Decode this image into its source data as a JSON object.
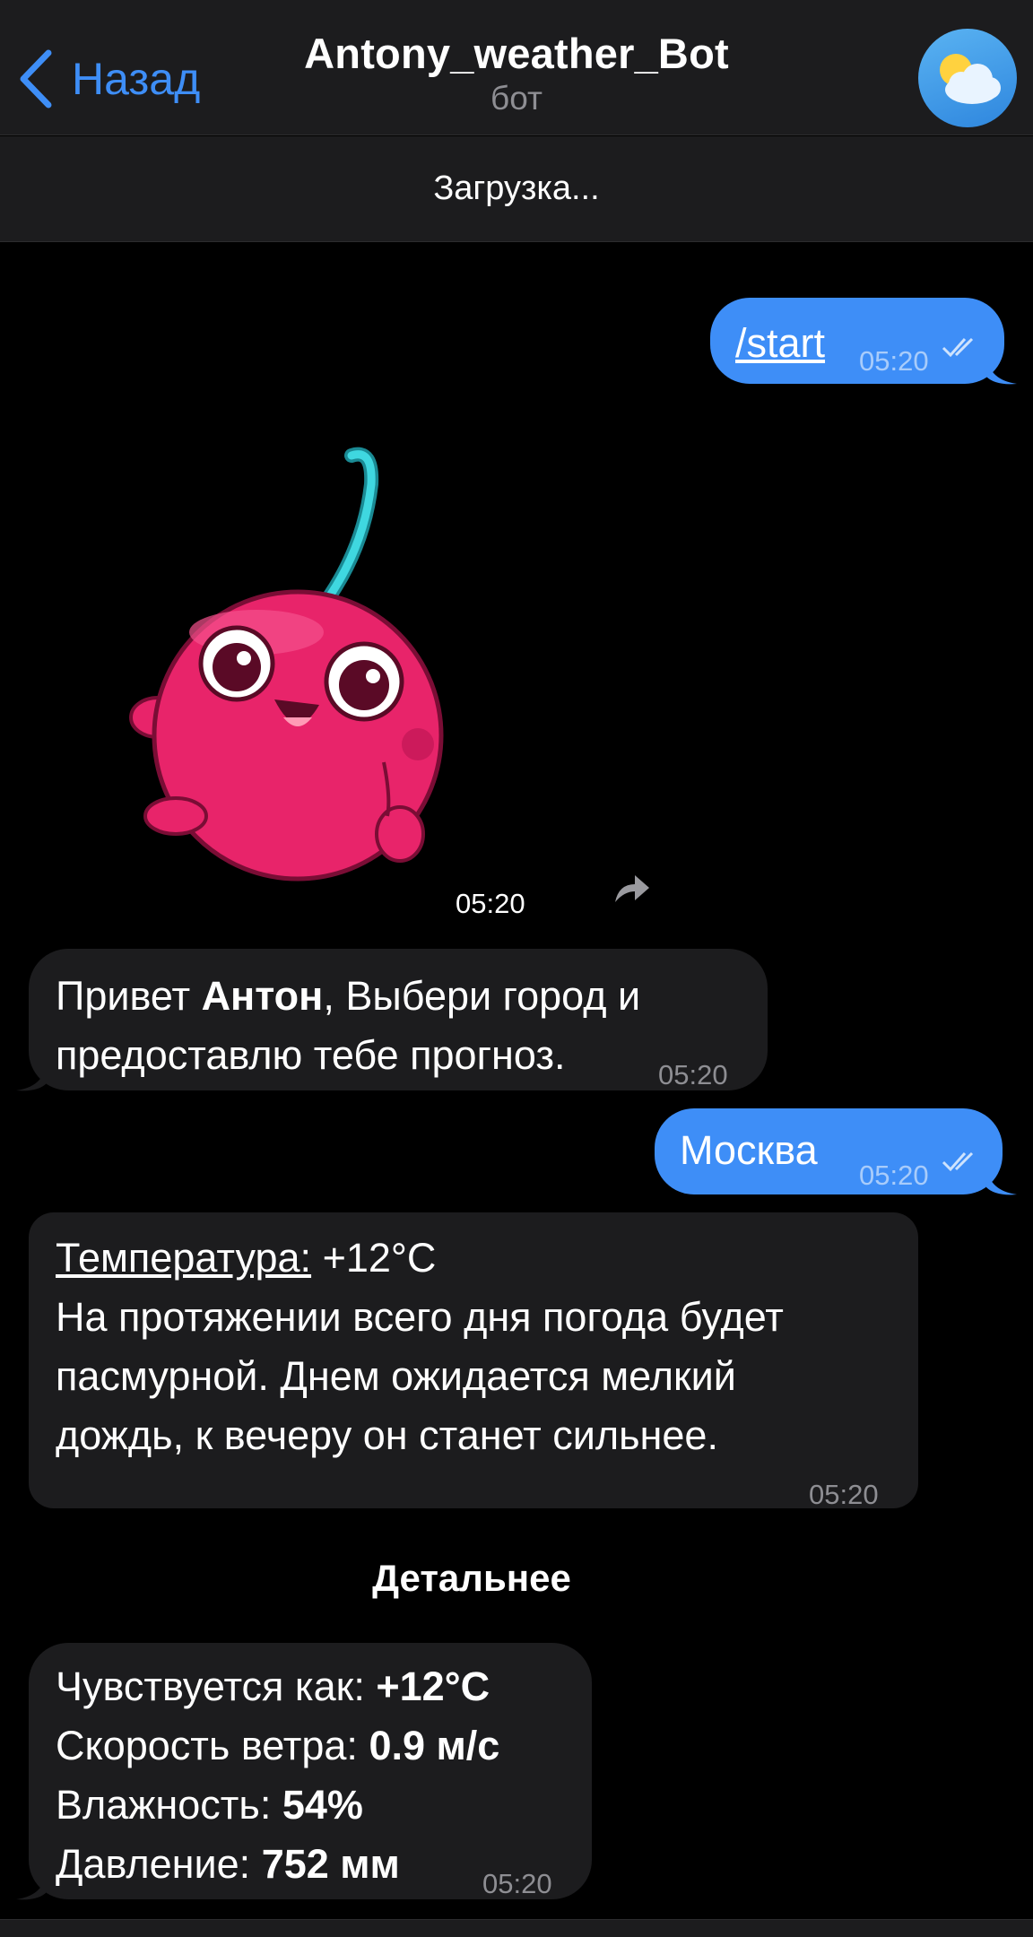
{
  "header": {
    "back_label": "Назад",
    "title": "Antony_weather_Bot",
    "subtitle": "бот",
    "avatar_icon": "weather-cloud-sun-icon"
  },
  "status_bar": {
    "label": "Загрузка..."
  },
  "messages": [
    {
      "type": "outgoing",
      "text": "/start",
      "time": "05:20",
      "status": "read"
    },
    {
      "type": "sticker",
      "time": "05:20"
    },
    {
      "type": "incoming",
      "text_before": "Привет ",
      "name": "Антон",
      "text_after": ", Выбери город и предоставлю тебе прогноз.",
      "time": "05:20"
    },
    {
      "type": "outgoing",
      "text": "Москва",
      "time": "05:20",
      "status": "read"
    },
    {
      "type": "incoming",
      "temp_label": "Температура:",
      "temp_value": " +12°C",
      "line1": "На протяжении всего дня погода будет",
      "line2": "пасмурной. Днем ожидается мелкий",
      "line3": "дождь, к вечеру он станет сильнее.",
      "time": "05:20"
    },
    {
      "type": "incoming",
      "details": [
        {
          "label": "Чувствуется как: ",
          "value": "+12°C"
        },
        {
          "label": "Скорость ветра: ",
          "value": "0.9 м/с"
        },
        {
          "label": "Влажность: ",
          "value": "54%"
        },
        {
          "label": "Давление: ",
          "value": "752 мм"
        }
      ],
      "time": "05:20"
    }
  ],
  "inline_button": {
    "label": "Детальнее"
  },
  "colors": {
    "outgoing": "#3e8ef7",
    "incoming": "#1c1c1e",
    "accent": "#3e8ef7"
  }
}
